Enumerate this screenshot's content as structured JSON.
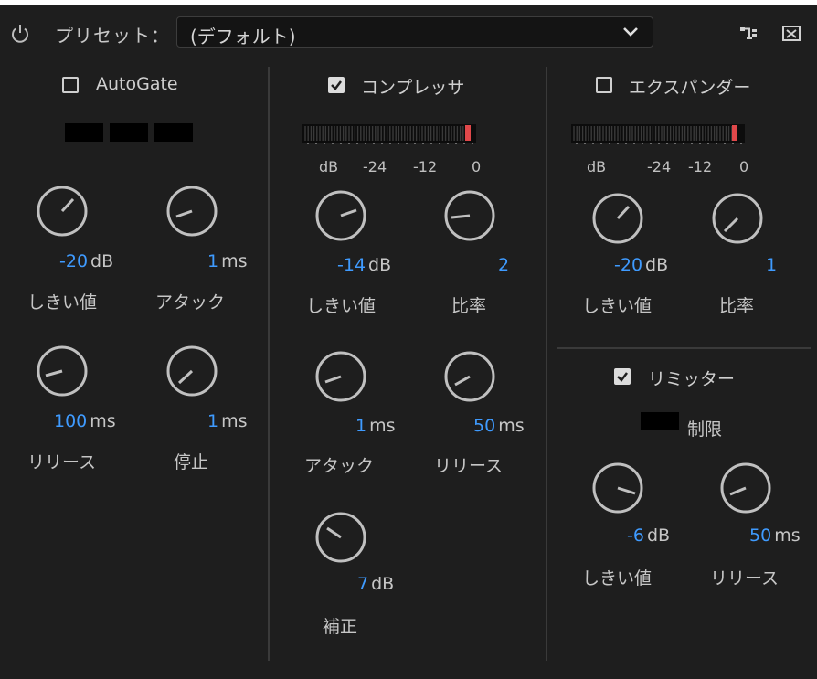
{
  "header": {
    "preset_label": "プリセット：",
    "preset_value": "(デフォルト)"
  },
  "autogate": {
    "title": "AutoGate",
    "enabled": false,
    "threshold": {
      "value": "-20",
      "unit": "dB",
      "label": "しきい値"
    },
    "attack": {
      "value": "1",
      "unit": "ms",
      "label": "アタック"
    },
    "release": {
      "value": "100",
      "unit": "ms",
      "label": "リリース"
    },
    "hold": {
      "value": "1",
      "unit": "ms",
      "label": "停止"
    }
  },
  "compressor": {
    "title": "コンプレッサ",
    "enabled": true,
    "scale": [
      "dB",
      "-24",
      "-12",
      "0"
    ],
    "threshold": {
      "value": "-14",
      "unit": "dB",
      "label": "しきい値"
    },
    "ratio": {
      "value": "2",
      "unit": "",
      "label": "比率"
    },
    "attack": {
      "value": "1",
      "unit": "ms",
      "label": "アタック"
    },
    "release": {
      "value": "50",
      "unit": "ms",
      "label": "リリース"
    },
    "makeup": {
      "value": "7",
      "unit": "dB",
      "label": "補正"
    }
  },
  "expander": {
    "title": "エクスパンダー",
    "enabled": false,
    "scale": [
      "dB",
      "-24",
      "-12",
      "0"
    ],
    "threshold": {
      "value": "-20",
      "unit": "dB",
      "label": "しきい値"
    },
    "ratio": {
      "value": "1",
      "unit": "",
      "label": "比率"
    }
  },
  "limiter": {
    "title": "リミッター",
    "enabled": true,
    "limit_label": "制限",
    "threshold": {
      "value": "-6",
      "unit": "dB",
      "label": "しきい値"
    },
    "release": {
      "value": "50",
      "unit": "ms",
      "label": "リリース"
    }
  },
  "colors": {
    "background": "#1e1e1e",
    "value_blue": "#3f9bff",
    "meter_peak": "#e0484a"
  }
}
